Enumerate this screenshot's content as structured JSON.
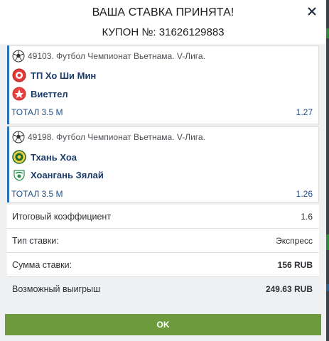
{
  "header": {
    "title": "ВАША СТАВКА ПРИНЯТА!",
    "coupon": "КУПОН №: 31626129883"
  },
  "bets": [
    {
      "event": "49103. Футбол Чемпионат Вьетнама. V-Лига.",
      "team1": "ТП Хо Ши Мин",
      "team2": "Виеттел",
      "market": "ТОТАЛ 3.5 М",
      "odd": "1.27"
    },
    {
      "event": "49198. Футбол Чемпионат Вьетнама. V-Лига.",
      "team1": "Тхань Хоа",
      "team2": "Хоангань Зялай",
      "market": "ТОТАЛ 3.5 М",
      "odd": "1.26"
    }
  ],
  "summary": {
    "total_coef_label": "Итоговый коэффициент",
    "total_coef_value": "1.6",
    "bet_type_label": "Тип ставки:",
    "bet_type_value": "Экспресс",
    "amount_label": "Сумма ставки:",
    "amount_value": "156 RUB",
    "win_label": "Возможный выигрыш",
    "win_value": "249.63 RUB"
  },
  "ok_label": "OK",
  "colors": {
    "accent": "#2b6fb6",
    "ok_button": "#6c9a3d",
    "team_text": "#1b3a66"
  }
}
